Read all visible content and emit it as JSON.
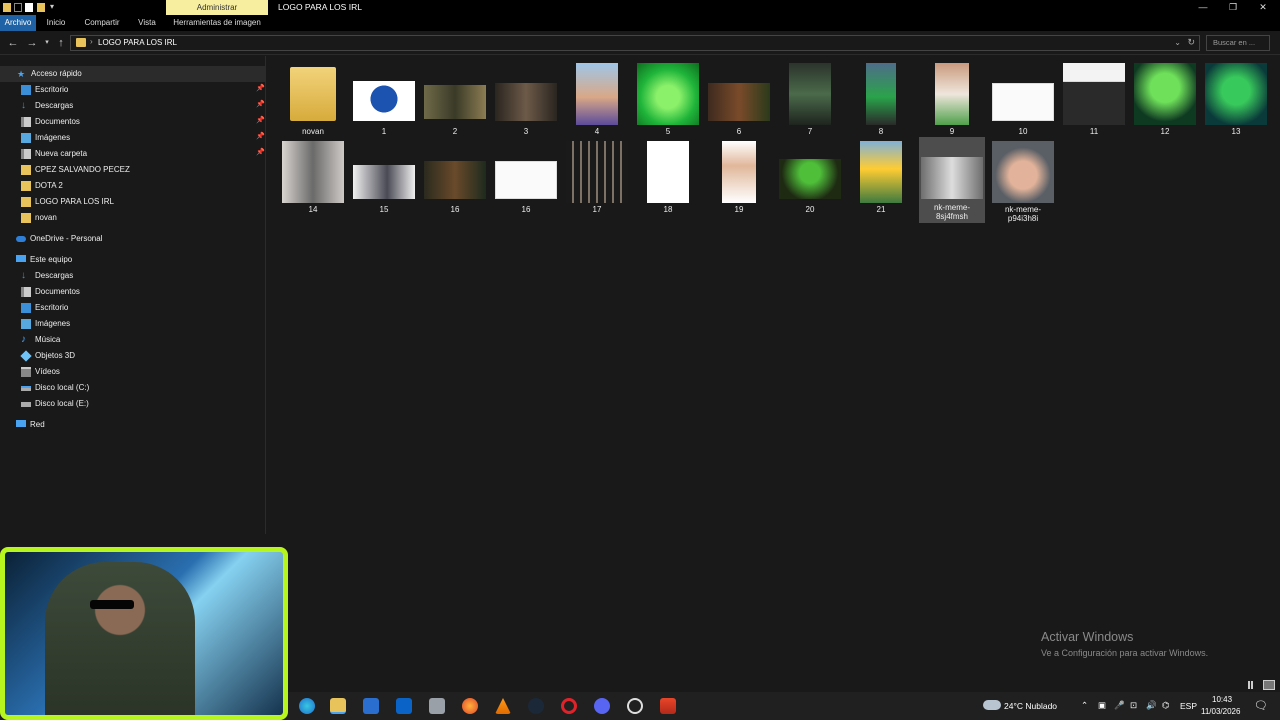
{
  "window": {
    "title": "LOGO PARA LOS IRL",
    "admin_tab": "Administrar",
    "controls": {
      "minimize": "—",
      "restore": "❐",
      "close": "✕"
    }
  },
  "ribbon": {
    "tabs": [
      "Archivo",
      "Inicio",
      "Compartir",
      "Vista",
      "Herramientas de imagen"
    ]
  },
  "address": {
    "path": "LOGO PARA LOS IRL",
    "search_placeholder": "Buscar en ..."
  },
  "sidebar": {
    "quick_access": "Acceso rápido",
    "quick_items": [
      "Escritorio",
      "Descargas",
      "Documentos",
      "Imágenes",
      "Nueva carpeta",
      "CPEZ SALVANDO PECEZ",
      "DOTA 2",
      "LOGO PARA LOS IRL",
      "novan"
    ],
    "onedrive": "OneDrive - Personal",
    "this_pc": "Este equipo",
    "pc_items": [
      "Descargas",
      "Documentos",
      "Escritorio",
      "Imágenes",
      "Música",
      "Objetos 3D",
      "Vídeos",
      "Disco local (C:)",
      "Disco local (E:)"
    ],
    "network": "Red"
  },
  "files": [
    {
      "name": "novan",
      "kind": "folder"
    },
    {
      "name": "1"
    },
    {
      "name": "2"
    },
    {
      "name": "3"
    },
    {
      "name": "4"
    },
    {
      "name": "5"
    },
    {
      "name": "6"
    },
    {
      "name": "7"
    },
    {
      "name": "8"
    },
    {
      "name": "9"
    },
    {
      "name": "10"
    },
    {
      "name": "11"
    },
    {
      "name": "12"
    },
    {
      "name": "13"
    },
    {
      "name": "14"
    },
    {
      "name": "15"
    },
    {
      "name": "16"
    },
    {
      "name": "16"
    },
    {
      "name": "17"
    },
    {
      "name": "18"
    },
    {
      "name": "19"
    },
    {
      "name": "20"
    },
    {
      "name": "21"
    },
    {
      "name": "nk-meme-8sj4fmsh",
      "selected": true
    },
    {
      "name": "nk-meme-p94i3h8i"
    }
  ],
  "watermark": {
    "line1": "Activar Windows",
    "line2": "Ve a Configuración para activar Windows."
  },
  "taskbar": {
    "weather": "24°C  Nublado",
    "lang": "ESP",
    "time": "10:43",
    "date": "11/03/2026"
  },
  "colors": {
    "accent": "#1f63a6",
    "admin_tab": "#f7eea0",
    "folder": "#e8c25a",
    "webcam_border": "#b6f51d"
  }
}
